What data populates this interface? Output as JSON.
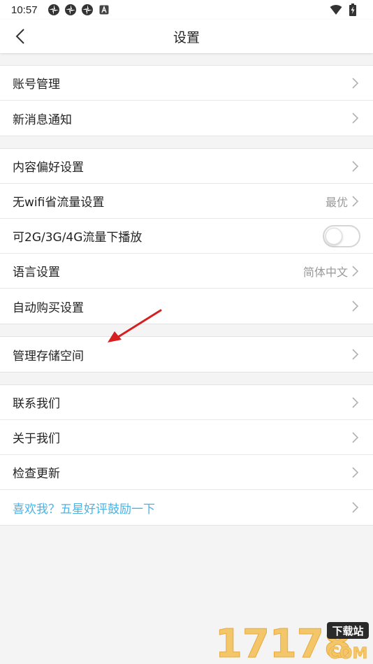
{
  "status_bar": {
    "time": "10:57",
    "notification_icons": [
      "pinwheel-icon",
      "pinwheel-icon",
      "pinwheel-icon",
      "a-icon"
    ],
    "wifi": "wifi-icon",
    "battery": "battery-charging-icon"
  },
  "header": {
    "title": "设置",
    "back_icon": "chevron-left-icon"
  },
  "groups": [
    {
      "items": [
        {
          "label": "账号管理"
        },
        {
          "label": "新消息通知"
        }
      ]
    },
    {
      "items": [
        {
          "label": "内容偏好设置"
        },
        {
          "label": "无wifi省流量设置",
          "value": "最优"
        },
        {
          "label": "可2G/3G/4G流量下播放",
          "toggle": false
        },
        {
          "label": "语言设置",
          "value": "简体中文"
        },
        {
          "label": "自动购买设置"
        }
      ]
    },
    {
      "items": [
        {
          "label": "管理存储空间"
        }
      ]
    },
    {
      "items": [
        {
          "label": "联系我们"
        },
        {
          "label": "关于我们"
        },
        {
          "label": "检查更新"
        },
        {
          "label": "喜欢我？五星好评鼓励一下"
        }
      ]
    }
  ],
  "watermark": {
    "text": "17178",
    "badge": "下载站",
    "sub": "COM"
  },
  "colors": {
    "accent": "#4bb3e6",
    "arrow": "#d62020"
  }
}
